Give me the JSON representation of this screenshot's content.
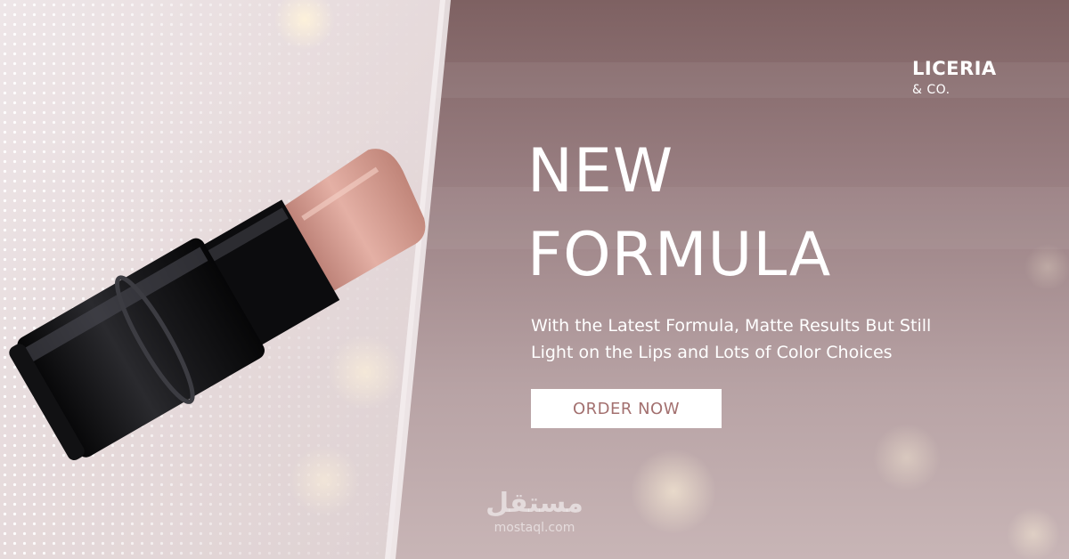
{
  "brand": {
    "name": "LICERIA",
    "sub": "& CO."
  },
  "hero": {
    "headline": [
      "NEW",
      "FORMULA"
    ],
    "subcopy": [
      "With the Latest Formula, Matte Results But Still",
      "Light on the Lips and Lots of Color Choices"
    ],
    "cta_label": "ORDER NOW"
  },
  "product": {
    "icon": "lipstick-icon"
  },
  "watermark": {
    "arabic": "مستقل",
    "url": "mostaql.com"
  },
  "colors": {
    "left_panel": "#ede3e4",
    "right_panel": "#9b8184",
    "cta_text": "#a3706f",
    "lipstick_bullet": "#cf9488",
    "lipstick_case": "#141416"
  }
}
